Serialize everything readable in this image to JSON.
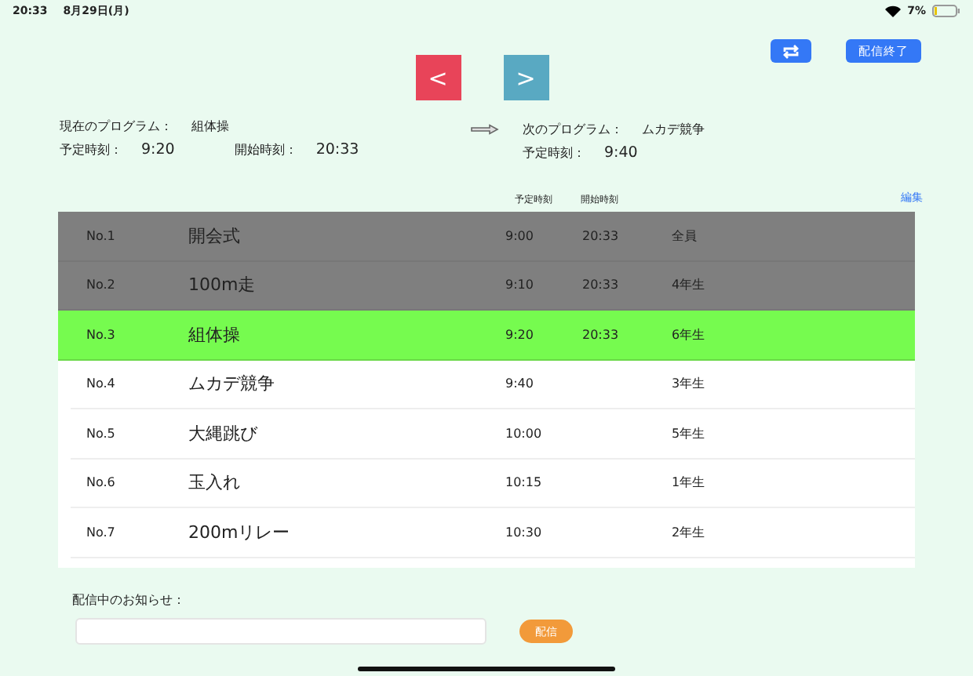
{
  "status_bar": {
    "time": "20:33",
    "date": "8月29日(月)",
    "battery_text": "7%"
  },
  "top_buttons": {
    "end_label": "配信終了"
  },
  "nav": {
    "prev": "<",
    "next": ">"
  },
  "current": {
    "label": "現在のプログラム：",
    "name": "組体操",
    "scheduled_label": "予定時刻：",
    "scheduled": "9:20",
    "start_label": "開始時刻：",
    "start": "20:33"
  },
  "next": {
    "label": "次のプログラム：",
    "name": "ムカデ競争",
    "scheduled_label": "予定時刻：",
    "scheduled": "9:40"
  },
  "table": {
    "columns": [
      "予定時刻",
      "開始時刻"
    ],
    "edit_link": "編集",
    "rows": [
      {
        "no": "No.1",
        "name": "開会式",
        "scheduled": "9:00",
        "start": "20:33",
        "participants": "全員",
        "done": true,
        "selected": false
      },
      {
        "no": "No.2",
        "name": "100m走",
        "scheduled": "9:10",
        "start": "20:33",
        "participants": "4年生",
        "done": true,
        "selected": false
      },
      {
        "no": "No.3",
        "name": "組体操",
        "scheduled": "9:20",
        "start": "20:33",
        "participants": "6年生",
        "done": true,
        "selected": true
      },
      {
        "no": "No.4",
        "name": "ムカデ競争",
        "scheduled": "9:40",
        "participants": "3年生",
        "done": false,
        "selected": false
      },
      {
        "no": "No.5",
        "name": "大縄跳び",
        "scheduled": "10:00",
        "participants": "5年生",
        "done": false,
        "selected": false
      },
      {
        "no": "No.6",
        "name": "玉入れ",
        "scheduled": "10:15",
        "participants": "1年生",
        "done": false,
        "selected": false
      },
      {
        "no": "No.7",
        "name": "200mリレー",
        "scheduled": "10:30",
        "participants": "2年生",
        "done": false,
        "selected": false
      }
    ]
  },
  "notice": {
    "label": "配信中のお知らせ：",
    "send_button": "配信"
  }
}
